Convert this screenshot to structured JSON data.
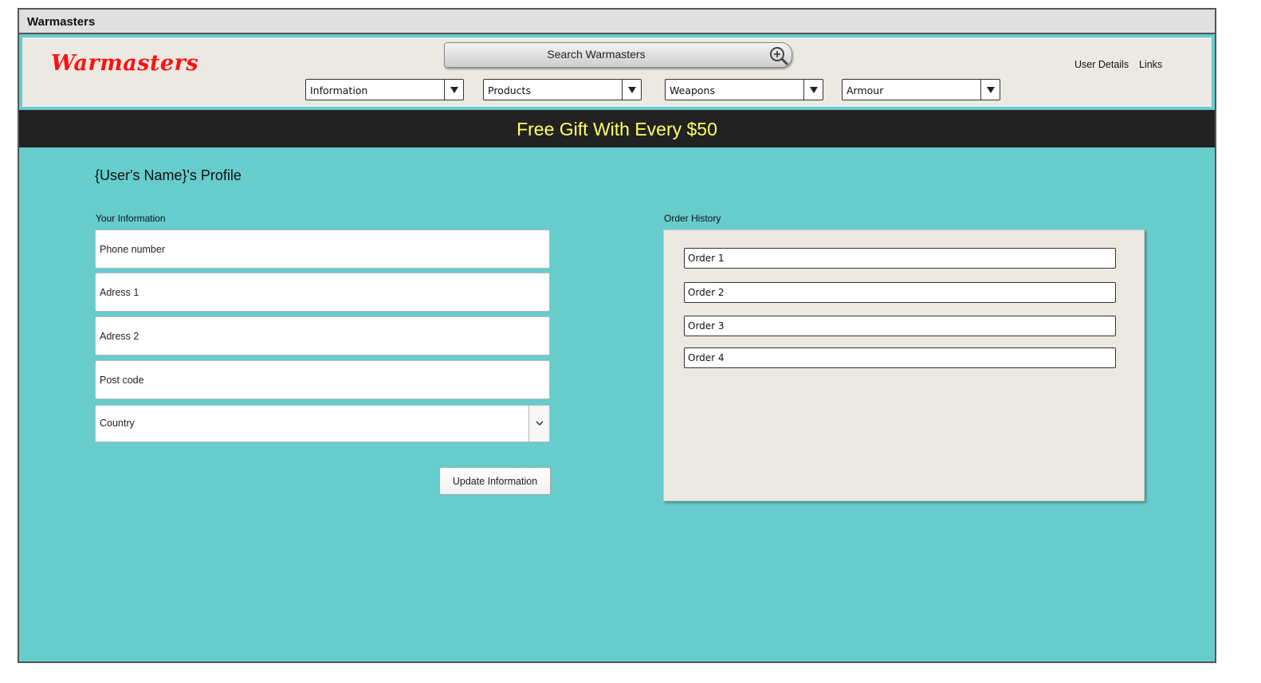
{
  "window": {
    "title": "Warmasters"
  },
  "header": {
    "logo": "Warmasters",
    "search_placeholder": "Search Warmasters",
    "menus": [
      "Information",
      "Products",
      "Weapons",
      "Armour"
    ],
    "links": [
      "User Details",
      "Links"
    ]
  },
  "banner": {
    "text": "Free Gift With Every $50"
  },
  "profile": {
    "title": "{User's Name}'s Profile",
    "info_label": "Your Information",
    "fields": {
      "phone": "Phone number",
      "address1": "Adress 1",
      "address2": "Adress 2",
      "postcode": "Post code"
    },
    "country": "Country",
    "update_button": "Update Information"
  },
  "orders": {
    "label": "Order History",
    "items": [
      "Order 1",
      "Order 2",
      "Order 3",
      "Order 4"
    ]
  },
  "colors": {
    "page_bg": "#66cccc",
    "banner_bg": "#222222",
    "banner_text": "#ffff66",
    "logo": "#ff1111",
    "panel_bg": "#ece9e3"
  }
}
